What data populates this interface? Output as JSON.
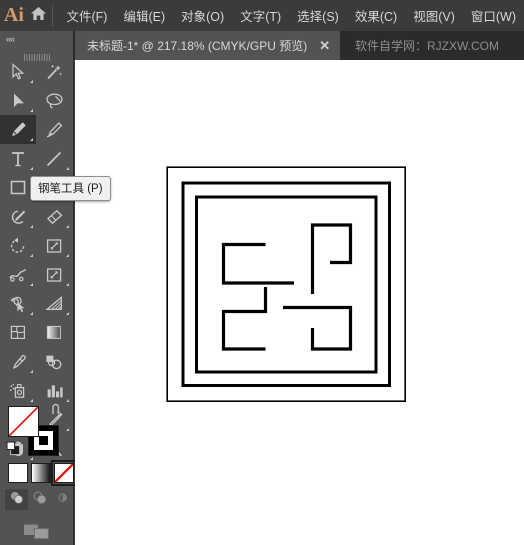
{
  "app": {
    "logo_text": "Ai",
    "home_icon": "home-icon"
  },
  "menubar": {
    "items": [
      {
        "label": "文件(F)",
        "name": "menu-file"
      },
      {
        "label": "编辑(E)",
        "name": "menu-edit"
      },
      {
        "label": "对象(O)",
        "name": "menu-object"
      },
      {
        "label": "文字(T)",
        "name": "menu-type"
      },
      {
        "label": "选择(S)",
        "name": "menu-select"
      },
      {
        "label": "效果(C)",
        "name": "menu-effect"
      },
      {
        "label": "视图(V)",
        "name": "menu-view"
      },
      {
        "label": "窗口(W)",
        "name": "menu-window"
      }
    ]
  },
  "tabstrip": {
    "document_tab": {
      "title": "未标题-1* @ 217.18% (CMYK/GPU 预览)",
      "close_label": "✕"
    },
    "watermark": "软件自学网：RJZXW.COM"
  },
  "toolpanel": {
    "collapse_label": "««",
    "tooltip": "钢笔工具 (P)",
    "tools": [
      {
        "name": "selection-tool",
        "icon": "cursor-arrow-outline-icon",
        "selected": false,
        "more": true
      },
      {
        "name": "magic-wand-tool",
        "icon": "magic-wand-icon",
        "selected": false,
        "more": false
      },
      {
        "name": "direct-selection-tool",
        "icon": "cursor-arrow-filled-icon",
        "selected": false,
        "more": true
      },
      {
        "name": "lasso-tool",
        "icon": "lasso-icon",
        "selected": false,
        "more": false
      },
      {
        "name": "pen-tool",
        "icon": "pen-icon",
        "selected": true,
        "more": true
      },
      {
        "name": "curvature-tool",
        "icon": "curvature-pen-icon",
        "selected": false,
        "more": false
      },
      {
        "name": "type-tool",
        "icon": "type-T-icon",
        "selected": false,
        "more": true
      },
      {
        "name": "line-segment-tool",
        "icon": "line-segment-icon",
        "selected": false,
        "more": true
      },
      {
        "name": "rectangle-tool",
        "icon": "rectangle-icon",
        "selected": false,
        "more": true
      },
      {
        "name": "paintbrush-tool",
        "icon": "paintbrush-icon",
        "selected": false,
        "more": true
      },
      {
        "name": "shaper-pencil-tool",
        "icon": "pencil-circle-icon",
        "selected": false,
        "more": true
      },
      {
        "name": "eraser-tool",
        "icon": "eraser-icon",
        "selected": false,
        "more": true
      },
      {
        "name": "rotate-tool",
        "icon": "rotate-icon",
        "selected": false,
        "more": true
      },
      {
        "name": "scale-tool",
        "icon": "scale-icon",
        "selected": false,
        "more": true
      },
      {
        "name": "width-tool",
        "icon": "width-warp-icon",
        "selected": false,
        "more": true
      },
      {
        "name": "free-transform-tool",
        "icon": "free-transform-icon",
        "selected": false,
        "more": true
      },
      {
        "name": "shape-builder-tool",
        "icon": "shape-builder-icon",
        "selected": false,
        "more": true
      },
      {
        "name": "perspective-grid-tool",
        "icon": "perspective-grid-icon",
        "selected": false,
        "more": true
      },
      {
        "name": "mesh-tool",
        "icon": "mesh-icon",
        "selected": false,
        "more": false
      },
      {
        "name": "gradient-tool",
        "icon": "gradient-icon",
        "selected": false,
        "more": false
      },
      {
        "name": "eyedropper-tool",
        "icon": "eyedropper-icon",
        "selected": false,
        "more": true
      },
      {
        "name": "blend-tool",
        "icon": "blend-icon",
        "selected": false,
        "more": false
      },
      {
        "name": "symbol-sprayer-tool",
        "icon": "symbol-sprayer-icon",
        "selected": false,
        "more": true
      },
      {
        "name": "column-graph-tool",
        "icon": "bar-graph-icon",
        "selected": false,
        "more": true
      },
      {
        "name": "artboard-tool",
        "icon": "artboard-icon",
        "selected": false,
        "more": false
      },
      {
        "name": "slice-tool",
        "icon": "slice-knife-icon",
        "selected": false,
        "more": true
      },
      {
        "name": "hand-tool",
        "icon": "hand-icon",
        "selected": false,
        "more": true
      },
      {
        "name": "zoom-tool",
        "icon": "magnifier-icon",
        "selected": false,
        "more": false
      }
    ],
    "color_controls": {
      "fill": {
        "name": "fill-swatch",
        "value": "none",
        "color": "#ffffff"
      },
      "stroke": {
        "name": "stroke-swatch",
        "value": "black",
        "color": "#000000"
      },
      "swap": "swap-fill-stroke-icon",
      "defaults": "default-fill-stroke-icon",
      "modes": [
        {
          "name": "color-mode-button",
          "icon": "solid-color-icon",
          "selected": false
        },
        {
          "name": "gradient-mode-button",
          "icon": "gradient-swatch-icon",
          "selected": false
        },
        {
          "name": "none-mode-button",
          "icon": "none-slash-icon",
          "selected": true
        }
      ],
      "screen_modes": [
        {
          "name": "drawing-normal-button",
          "icon": "draw-normal-icon",
          "active": true
        },
        {
          "name": "drawing-behind-button",
          "icon": "draw-behind-icon",
          "active": false
        },
        {
          "name": "drawing-inside-button",
          "icon": "draw-inside-icon",
          "active": false
        }
      ],
      "screen_mode_toggle": {
        "name": "screen-mode-button",
        "icon": "screen-mode-icon"
      }
    }
  },
  "canvas": {
    "artboard": {
      "name": "artboard",
      "description": "decorative nested square frame pattern with four rotational hook motifs"
    },
    "zoom_level": "217.18%",
    "color_mode": "CMYK/GPU 预览"
  },
  "colors": {
    "menubar_bg": "#3b3b3b",
    "tabstrip_bg": "#2b2b2b",
    "tab_active_bg": "#535353",
    "toolpanel_bg": "#535353",
    "tool_selected_bg": "#323232",
    "canvas_bg": "#ffffff",
    "text_primary": "#d6d6d6",
    "text_muted": "#8d8d8d",
    "logo_accent": "#d69a6a",
    "artwork_stroke": "#000000"
  }
}
